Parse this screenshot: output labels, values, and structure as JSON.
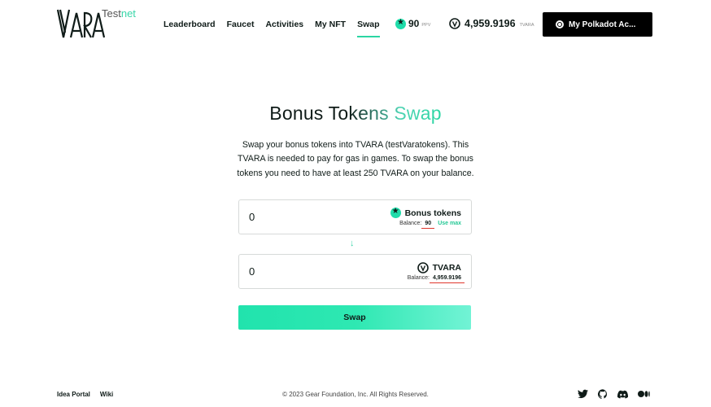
{
  "header": {
    "logo_text": "VARA",
    "logo_tag": "Test",
    "logo_tag_accent": "net",
    "nav": [
      {
        "label": "Leaderboard"
      },
      {
        "label": "Faucet"
      },
      {
        "label": "Activities"
      },
      {
        "label": "My NFT"
      },
      {
        "label": "Swap",
        "active": true
      }
    ],
    "ppv_value": "90",
    "ppv_unit": "PPV",
    "tvara_value": "4,959.9196",
    "tvara_unit": "TVARA",
    "account_label": "My Polkadot Ac...",
    "accent_color": "#2bd6a3"
  },
  "main": {
    "title_plain": "Bonus To",
    "title_accent": "kens Swap",
    "description": "Swap your bonus tokens into TVARA (testVaratokens). This TVARA is needed to pay for gas in games. To swap the bonus tokens you need to have at least 250 TVARA on your balance.",
    "from": {
      "value": "0",
      "token_label": "Bonus tokens",
      "icon": "star-icon",
      "balance_label": "Balance:",
      "balance_value": "90",
      "use_max": "Use max"
    },
    "arrow": "↓",
    "to": {
      "value": "0",
      "token_label": "TVARA",
      "icon": "vara-icon",
      "balance_label": "Balance:",
      "balance_value": "4,959.9196"
    },
    "swap_label": "Swap"
  },
  "footer": {
    "links": [
      "Idea Portal",
      "Wiki"
    ],
    "copyright": "© 2023 Gear Foundation, Inc. All Rights Reserved.",
    "socials": [
      "twitter-icon",
      "github-icon",
      "discord-icon",
      "medium-icon"
    ]
  }
}
